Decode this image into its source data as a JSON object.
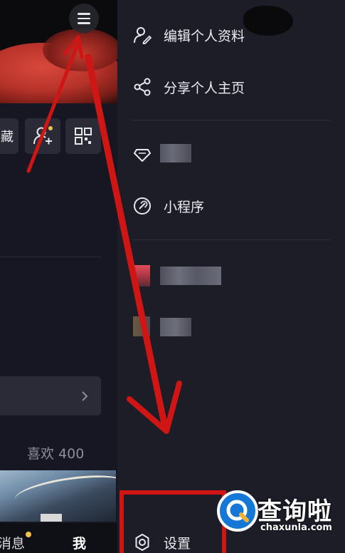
{
  "left_page": {
    "collect_label": "藏",
    "likes_text": "喜欢 400",
    "tabs": {
      "message": "消息",
      "me": "我"
    }
  },
  "drawer": {
    "items": [
      {
        "label": "编辑个人资料",
        "icon": "edit-profile-icon"
      },
      {
        "label": "分享个人主页",
        "icon": "share-icon"
      },
      {
        "label": "",
        "icon": "diamond-icon"
      },
      {
        "label": "小程序",
        "icon": "link-icon"
      },
      {
        "label": "",
        "icon": "app-thumbnail-icon"
      },
      {
        "label": "",
        "icon": "app-thumbnail-icon"
      },
      {
        "label": "设置",
        "icon": "gear-icon"
      }
    ]
  },
  "annotation": {
    "color": "#d01515"
  },
  "watermark": {
    "name": "查询啦",
    "url": "chaxunla.com"
  }
}
